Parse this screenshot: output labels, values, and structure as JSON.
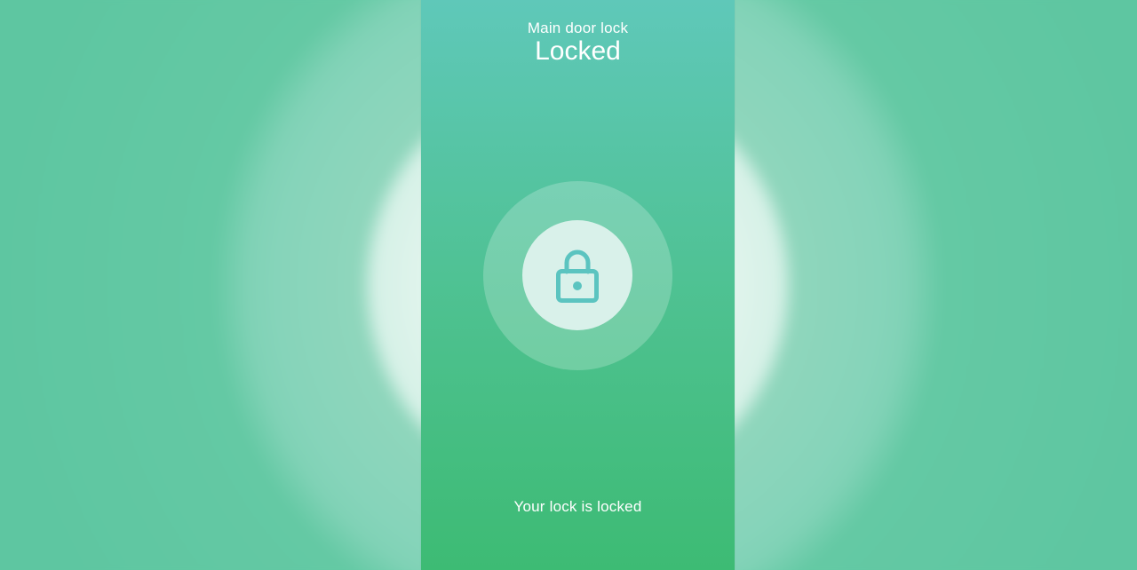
{
  "header": {
    "device_name": "Main door lock",
    "lock_state": "Locked"
  },
  "lock_button": {
    "icon": "lock-icon",
    "icon_color": "#5bc4c0"
  },
  "footer": {
    "status_message": "Your lock is locked"
  },
  "colors": {
    "gradient_top": "#5fc8b9",
    "gradient_bottom": "#3dbb74",
    "backdrop": "#62c9a6"
  }
}
